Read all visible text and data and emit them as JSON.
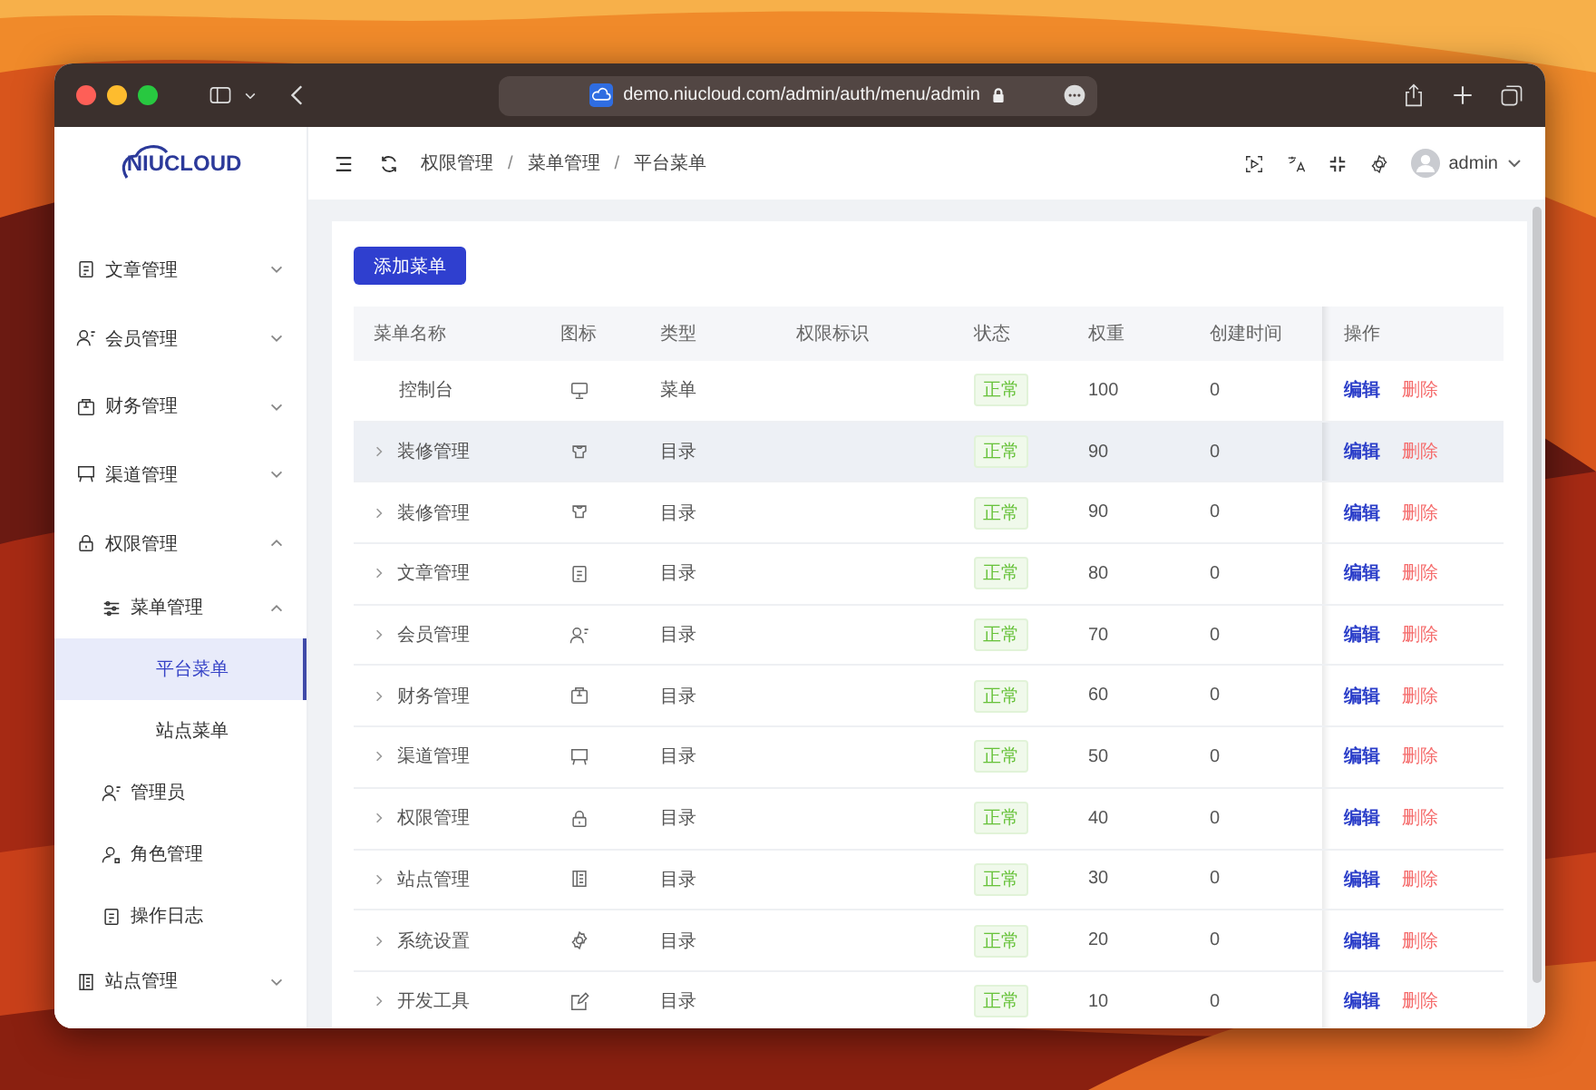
{
  "browser": {
    "url": "demo.niucloud.com/admin/auth/menu/admin"
  },
  "logo": {
    "text": "NIUCLOUD"
  },
  "sidebar": {
    "items": [
      {
        "label": "文章管理",
        "expanded": false,
        "selected": false
      },
      {
        "label": "会员管理",
        "expanded": false,
        "selected": false
      },
      {
        "label": "财务管理",
        "expanded": false,
        "selected": false
      },
      {
        "label": "渠道管理",
        "expanded": false,
        "selected": false
      },
      {
        "label": "权限管理",
        "expanded": true,
        "selected": false,
        "children": [
          {
            "label": "菜单管理",
            "expanded": true,
            "selected": false,
            "children": [
              {
                "label": "平台菜单",
                "selected": true
              },
              {
                "label": "站点菜单",
                "selected": false
              }
            ]
          },
          {
            "label": "管理员",
            "selected": false
          },
          {
            "label": "角色管理",
            "selected": false
          },
          {
            "label": "操作日志",
            "selected": false
          }
        ]
      },
      {
        "label": "站点管理",
        "expanded": false,
        "selected": false
      }
    ]
  },
  "header": {
    "breadcrumb": [
      "权限管理",
      "菜单管理",
      "平台菜单"
    ],
    "separator": "/",
    "user": "admin"
  },
  "add_button": "添加菜单",
  "table": {
    "columns": [
      "菜单名称",
      "图标",
      "类型",
      "权限标识",
      "状态",
      "权重",
      "创建时间",
      "操作"
    ],
    "rows": [
      {
        "name": "控制台",
        "expandable": false,
        "type": "菜单",
        "status": "正常",
        "weight": "100",
        "created": "0",
        "edit": "编辑",
        "delete": "删除",
        "highlighted": false
      },
      {
        "name": "装修管理",
        "expandable": true,
        "type": "目录",
        "status": "正常",
        "weight": "90",
        "created": "0",
        "edit": "编辑",
        "delete": "删除",
        "highlighted": true
      },
      {
        "name": "装修管理",
        "expandable": true,
        "type": "目录",
        "status": "正常",
        "weight": "90",
        "created": "0",
        "edit": "编辑",
        "delete": "删除",
        "highlighted": false
      },
      {
        "name": "文章管理",
        "expandable": true,
        "type": "目录",
        "status": "正常",
        "weight": "80",
        "created": "0",
        "edit": "编辑",
        "delete": "删除",
        "highlighted": false
      },
      {
        "name": "会员管理",
        "expandable": true,
        "type": "目录",
        "status": "正常",
        "weight": "70",
        "created": "0",
        "edit": "编辑",
        "delete": "删除",
        "highlighted": false
      },
      {
        "name": "财务管理",
        "expandable": true,
        "type": "目录",
        "status": "正常",
        "weight": "60",
        "created": "0",
        "edit": "编辑",
        "delete": "删除",
        "highlighted": false
      },
      {
        "name": "渠道管理",
        "expandable": true,
        "type": "目录",
        "status": "正常",
        "weight": "50",
        "created": "0",
        "edit": "编辑",
        "delete": "删除",
        "highlighted": false
      },
      {
        "name": "权限管理",
        "expandable": true,
        "type": "目录",
        "status": "正常",
        "weight": "40",
        "created": "0",
        "edit": "编辑",
        "delete": "删除",
        "highlighted": false
      },
      {
        "name": "站点管理",
        "expandable": true,
        "type": "目录",
        "status": "正常",
        "weight": "30",
        "created": "0",
        "edit": "编辑",
        "delete": "删除",
        "highlighted": false
      },
      {
        "name": "系统设置",
        "expandable": true,
        "type": "目录",
        "status": "正常",
        "weight": "20",
        "created": "0",
        "edit": "编辑",
        "delete": "删除",
        "highlighted": false
      },
      {
        "name": "开发工具",
        "expandable": true,
        "type": "目录",
        "status": "正常",
        "weight": "10",
        "created": "0",
        "edit": "编辑",
        "delete": "删除",
        "highlighted": false
      }
    ]
  }
}
